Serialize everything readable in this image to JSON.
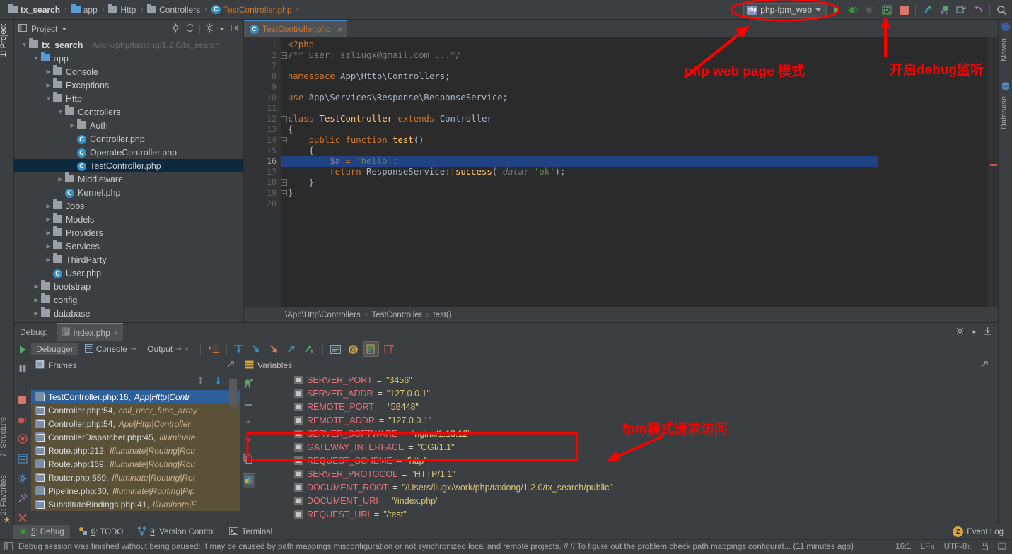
{
  "navbar": {
    "breadcrumbs": [
      {
        "label": "tx_search",
        "icon": "folder-icon",
        "bold": true
      },
      {
        "label": "app",
        "icon": "folder-icon-blue",
        "bold": false
      },
      {
        "label": "Http",
        "icon": "folder-icon",
        "bold": false
      },
      {
        "label": "Controllers",
        "icon": "folder-icon",
        "bold": false
      },
      {
        "label": "TestController.php",
        "icon": "php-class-icon",
        "bold": false,
        "file": true
      }
    ],
    "run_config": "php-fpm_web",
    "buttons": [
      "run-button",
      "debug-button",
      "debug-disabled-button",
      "coverage-button",
      "stop-button",
      "attach-debugger-button",
      "listen-debug-button",
      "screenshot-button",
      "undo-button",
      "search-everywhere-button"
    ]
  },
  "project_panel": {
    "title": "Project",
    "tree": [
      {
        "depth": 0,
        "arrow": "down",
        "icon": "folder-icon",
        "label": "tx_search",
        "bold": true,
        "path": "~/work/php/taxiong/1.2.0/tx_search"
      },
      {
        "depth": 1,
        "arrow": "down",
        "icon": "folder-icon-blue",
        "label": "app"
      },
      {
        "depth": 2,
        "arrow": "right",
        "icon": "folder-icon",
        "label": "Console"
      },
      {
        "depth": 2,
        "arrow": "right",
        "icon": "folder-icon",
        "label": "Exceptions"
      },
      {
        "depth": 2,
        "arrow": "down",
        "icon": "folder-icon",
        "label": "Http"
      },
      {
        "depth": 3,
        "arrow": "down",
        "icon": "folder-icon",
        "label": "Controllers"
      },
      {
        "depth": 4,
        "arrow": "right",
        "icon": "folder-icon",
        "label": "Auth"
      },
      {
        "depth": 4,
        "arrow": "none",
        "icon": "php-class-icon",
        "label": "Controller.php"
      },
      {
        "depth": 4,
        "arrow": "none",
        "icon": "php-class-icon",
        "label": "OperateController.php"
      },
      {
        "depth": 4,
        "arrow": "none",
        "icon": "php-class-icon",
        "label": "TestController.php",
        "selected": true
      },
      {
        "depth": 3,
        "arrow": "right",
        "icon": "folder-icon",
        "label": "Middleware"
      },
      {
        "depth": 3,
        "arrow": "none",
        "icon": "php-class-icon",
        "label": "Kernel.php"
      },
      {
        "depth": 2,
        "arrow": "right",
        "icon": "folder-icon",
        "label": "Jobs"
      },
      {
        "depth": 2,
        "arrow": "right",
        "icon": "folder-icon",
        "label": "Models"
      },
      {
        "depth": 2,
        "arrow": "right",
        "icon": "folder-icon",
        "label": "Providers"
      },
      {
        "depth": 2,
        "arrow": "right",
        "icon": "folder-icon",
        "label": "Services"
      },
      {
        "depth": 2,
        "arrow": "right",
        "icon": "folder-icon",
        "label": "ThirdParty"
      },
      {
        "depth": 2,
        "arrow": "none",
        "icon": "php-class-icon",
        "label": "User.php"
      },
      {
        "depth": 1,
        "arrow": "right",
        "icon": "folder-icon",
        "label": "bootstrap"
      },
      {
        "depth": 1,
        "arrow": "right",
        "icon": "folder-icon",
        "label": "config"
      },
      {
        "depth": 1,
        "arrow": "right",
        "icon": "folder-icon",
        "label": "database"
      }
    ]
  },
  "editor": {
    "tab": "TestController.php",
    "lines": [
      {
        "n": "1",
        "html": "<span class=\"kw\">&lt;?php</span>"
      },
      {
        "n": "2",
        "html": "<span class=\"cmt\">/** User: szliugx@gmail.com ...*/</span>",
        "fold": true
      },
      {
        "n": "7",
        "html": ""
      },
      {
        "n": "8",
        "html": "<span class=\"kw\">namespace</span> App\\Http\\Controllers;"
      },
      {
        "n": "9",
        "html": ""
      },
      {
        "n": "10",
        "html": "<span class=\"kw\">use</span> App\\Services\\Response\\ResponseService;"
      },
      {
        "n": "11",
        "html": ""
      },
      {
        "n": "12",
        "html": "<span class=\"kw\">class</span> <span class=\"fn\">TestController</span> <span class=\"kw\">extends</span> Controller",
        "fold": true
      },
      {
        "n": "13",
        "html": "{"
      },
      {
        "n": "14",
        "html": "    <span class=\"kw\">public function</span> <span class=\"fn\">test</span>()",
        "fold": true
      },
      {
        "n": "15",
        "html": "    {"
      },
      {
        "n": "16",
        "html": "        <span class=\"var\">$a</span> <span class=\"kw\">=</span> <span class=\"str\">'hello'</span>;",
        "highlight": true,
        "breakpoint": true
      },
      {
        "n": "17",
        "html": "        <span class=\"kw\">return</span> ResponseService<span class=\"kw\">::</span><span class=\"fn\">success</span>( <span class=\"hint\">data:</span> <span class=\"str\">'ok'</span>);"
      },
      {
        "n": "18",
        "html": "    }",
        "fold": true
      },
      {
        "n": "19",
        "html": "}",
        "fold": true
      },
      {
        "n": "20",
        "html": ""
      }
    ],
    "breadcrumbs": [
      "\\App\\Http\\Controllers",
      "TestController",
      "test()"
    ]
  },
  "debug": {
    "label": "Debug:",
    "session_tab": "index.php",
    "tabs": [
      {
        "label": "Debugger",
        "active": true
      },
      {
        "label": "Console",
        "active": false
      },
      {
        "label": "Output",
        "active": false
      }
    ],
    "frames_title": "Frames",
    "frames": [
      {
        "name": "TestController.php:16,",
        "ns": "App|Http|Contr",
        "selected": true
      },
      {
        "name": "Controller.php:54,",
        "ns": "call_user_func_array"
      },
      {
        "name": "Controller.php:54,",
        "ns": "App|Http|Controller"
      },
      {
        "name": "ControllerDispatcher.php:45,",
        "ns": "Illuminate"
      },
      {
        "name": "Route.php:212,",
        "ns": "Illuminate|Routing|Rou"
      },
      {
        "name": "Route.php:169,",
        "ns": "Illuminate|Routing|Rou"
      },
      {
        "name": "Router.php:659,",
        "ns": "Illuminate|Routing|Rot"
      },
      {
        "name": "Pipeline.php:30,",
        "ns": "Illuminate|Routing|Pip"
      },
      {
        "name": "SubstituteBindings.php:41,",
        "ns": "Illuminate|F"
      }
    ],
    "variables_title": "Variables",
    "variables": [
      {
        "name": "SERVER_PORT",
        "value": "\"3456\""
      },
      {
        "name": "SERVER_ADDR",
        "value": "\"127.0.0.1\""
      },
      {
        "name": "REMOTE_PORT",
        "value": "\"58448\""
      },
      {
        "name": "REMOTE_ADDR",
        "value": "\"127.0.0.1\""
      },
      {
        "name": "SERVER_SOFTWARE",
        "value": "\"nginx/1.13.12\""
      },
      {
        "name": "GATEWAY_INTERFACE",
        "value": "\"CGI/1.1\""
      },
      {
        "name": "REQUEST_SCHEME",
        "value": "\"http\""
      },
      {
        "name": "SERVER_PROTOCOL",
        "value": "\"HTTP/1.1\""
      },
      {
        "name": "DOCUMENT_ROOT",
        "value": "\"/Users/liugx/work/php/taxiong/1.2.0/tx_search/public\""
      },
      {
        "name": "DOCUMENT_URI",
        "value": "\"/index.php\""
      },
      {
        "name": "REQUEST_URI",
        "value": "\"/test\""
      }
    ]
  },
  "left_strip": {
    "items": [
      {
        "label": "1: Project"
      },
      {
        "label": "7: Structure"
      },
      {
        "label": "2: Favorites"
      }
    ]
  },
  "right_strip": {
    "items": [
      {
        "label": "Maven"
      },
      {
        "label": "Database"
      }
    ]
  },
  "toolwindow_bar": {
    "buttons": [
      {
        "num": "5",
        "label": ": Debug",
        "icon": "bug-icon",
        "active": true
      },
      {
        "num": "6",
        "label": ": TODO",
        "icon": "todo-icon",
        "active": false
      },
      {
        "num": "9",
        "label": ": Version Control",
        "icon": "vcs-icon",
        "active": false
      },
      {
        "num": "",
        "label": "Terminal",
        "icon": "terminal-icon",
        "active": false
      }
    ],
    "event_log": "Event Log",
    "event_log_count": "2"
  },
  "statusbar": {
    "message": "Debug session was finished without being paused: It may be caused by path mappings misconfiguration or not synchronized local and remote projects. // // To figure out the problem check path mappings configurat... (11 minutes ago)",
    "caret": "16:1",
    "line_separator": "LF",
    "encoding": "UTF-8"
  },
  "annotations": {
    "run_config_note": "php web page 模式",
    "debug_listen_note": "开启debug监听",
    "fpm_note": "fpm模式请求访问",
    "color": "#ff0000"
  }
}
